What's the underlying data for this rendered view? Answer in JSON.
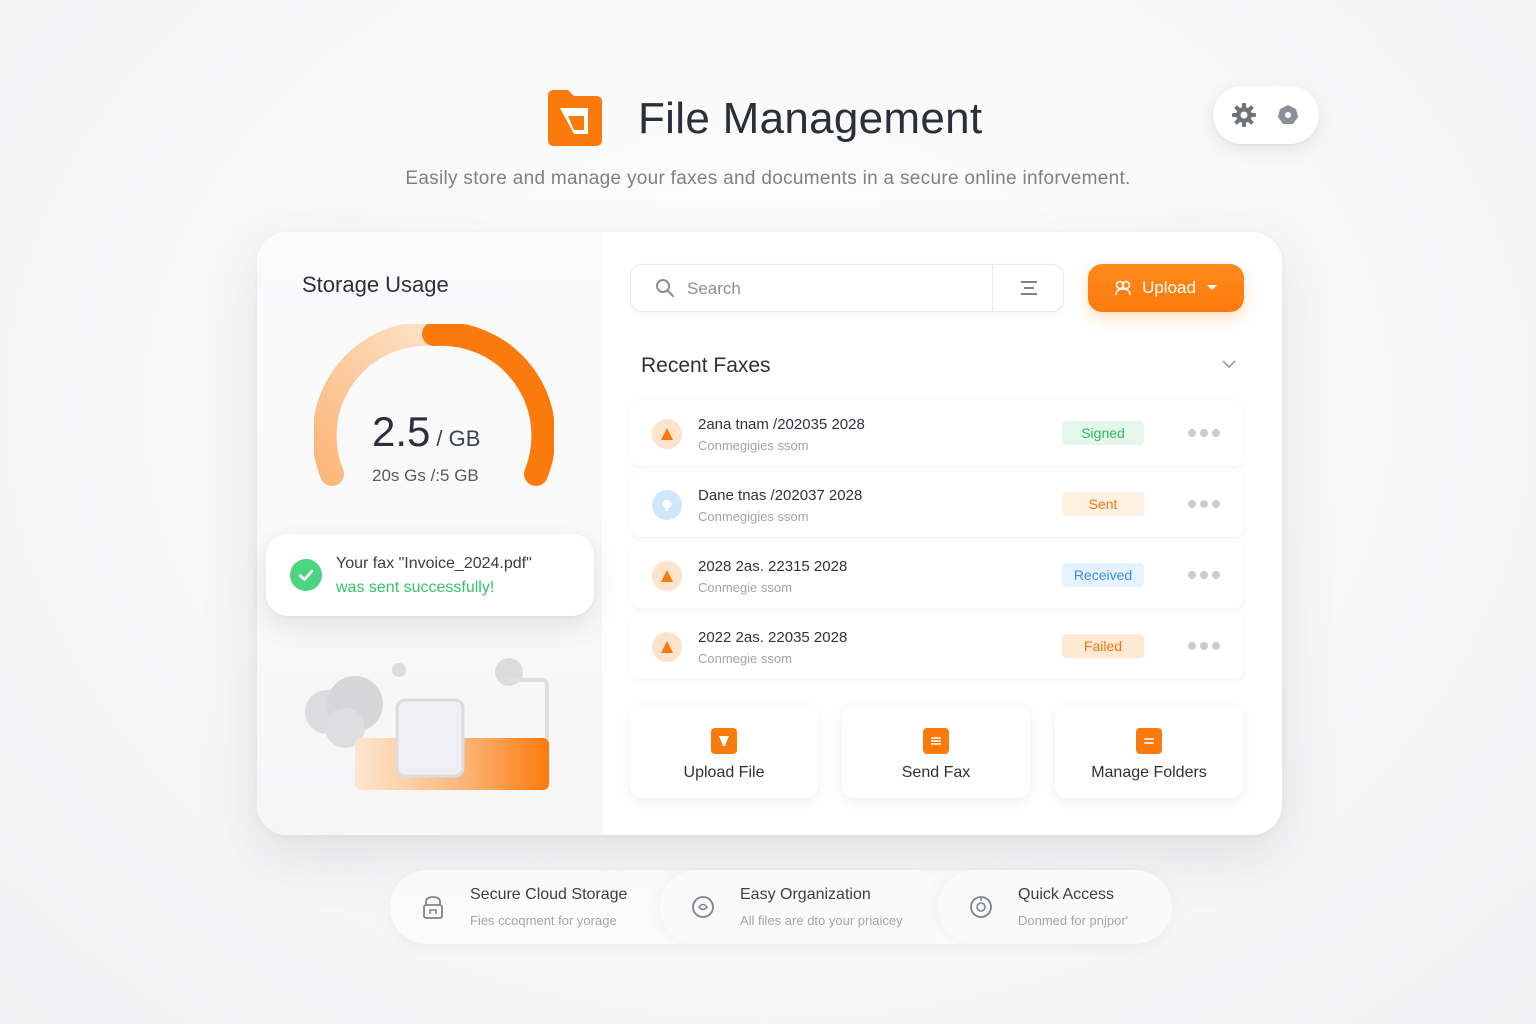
{
  "app": {
    "title": "File Management",
    "subtitle": "Easily store and manage your faxes and documents in a secure online inforvement."
  },
  "colors": {
    "accent": "#fb7a0c",
    "success": "#36c26c",
    "signed_bg": "#e3f8ea",
    "signed_fg": "#2fb765",
    "sent_bg": "#fff0e0",
    "sent_fg": "#f07a12",
    "received_bg": "#e6f2fd",
    "received_fg": "#3a8ee6",
    "failed_bg": "#ffe9d3",
    "failed_fg": "#f07a12"
  },
  "header_actions": {
    "icons": [
      "gear-icon",
      "circle-icon"
    ]
  },
  "storage": {
    "title": "Storage Usage",
    "used_value": "2.5",
    "used_unit": "/ GB",
    "sub_text": "20s Gs /:5 GB",
    "fill_fraction": 0.5
  },
  "toast": {
    "line1": "Your fax \"Invoice_2024.pdf\"",
    "line2": "was sent successfully!"
  },
  "search": {
    "placeholder": "Search"
  },
  "upload_button": {
    "label": "Upload"
  },
  "recent": {
    "title": "Recent Faxes",
    "items": [
      {
        "name": "2ana tnam /202035 2028",
        "sub": "Conmegigies ssom",
        "status": "Signed",
        "icon": "document-icon"
      },
      {
        "name": "Dane tnas /202037 2028",
        "sub": "Conmegigies ssom",
        "status": "Sent",
        "icon": "bulb-icon"
      },
      {
        "name": "2028 2as. 22315 2028",
        "sub": "Conmegie ssom",
        "status": "Received",
        "icon": "document-icon"
      },
      {
        "name": "2022 2as. 22035 2028",
        "sub": "Conmegie ssom",
        "status": "Failed",
        "icon": "document-icon"
      }
    ]
  },
  "tiles": [
    {
      "label": "Upload File",
      "icon": "upload-file-icon"
    },
    {
      "label": "Send Fax",
      "icon": "send-fax-icon"
    },
    {
      "label": "Manage Folders",
      "icon": "folder-icon"
    }
  ],
  "features": [
    {
      "title": "Secure Cloud Storage",
      "desc": "Fies ccoqment for yorage",
      "icon": "lock-icon"
    },
    {
      "title": "Easy Organization",
      "desc": "All files are dto your priaicey",
      "icon": "shield-icon"
    },
    {
      "title": "Quick Access",
      "desc": "Donmed for pnjpor'",
      "icon": "access-icon"
    }
  ]
}
